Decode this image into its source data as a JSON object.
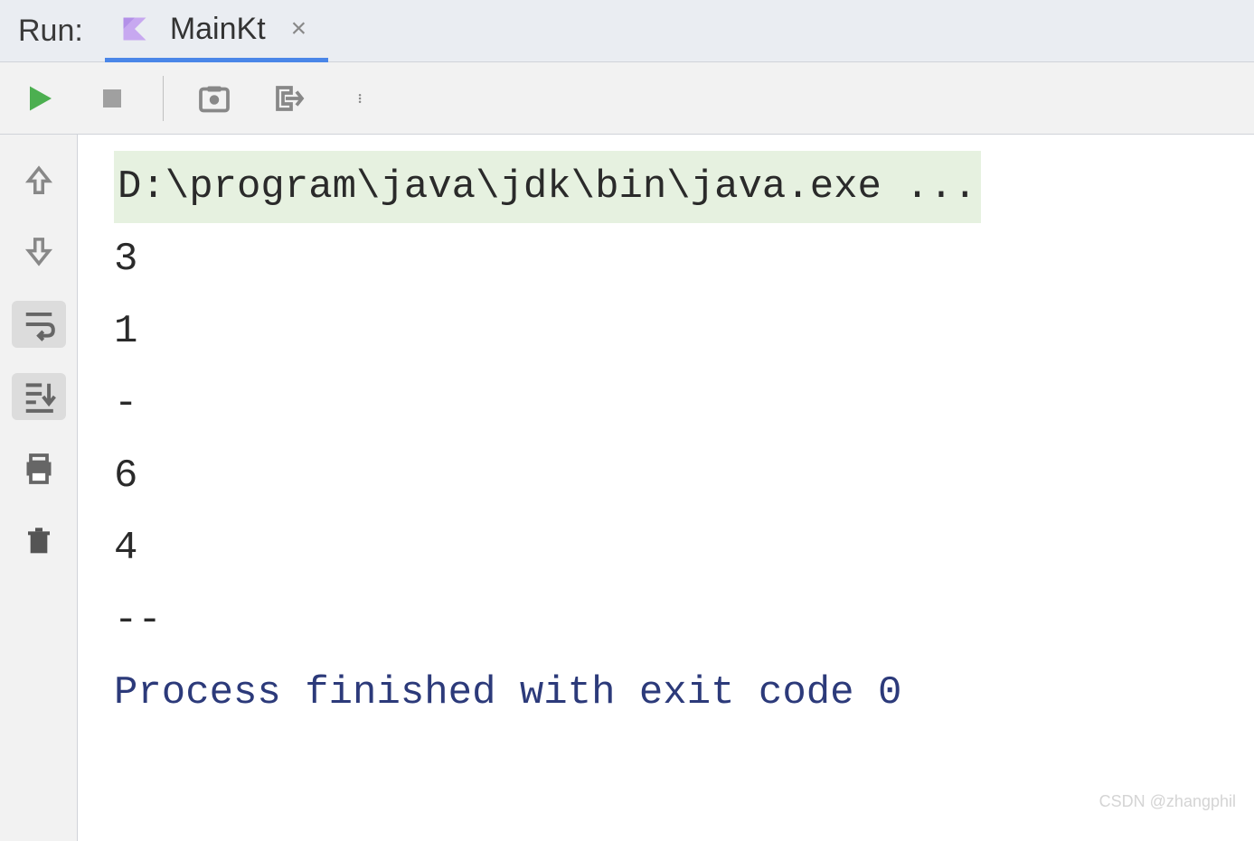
{
  "header": {
    "run_label": "Run:",
    "tab_label": "MainKt"
  },
  "console": {
    "command": "D:\\program\\java\\jdk\\bin\\java.exe ...",
    "lines": [
      "3",
      "1",
      "-",
      "6",
      "4",
      "--",
      ""
    ],
    "exit_message": "Process finished with exit code 0"
  },
  "watermark": "CSDN @zhangphil"
}
